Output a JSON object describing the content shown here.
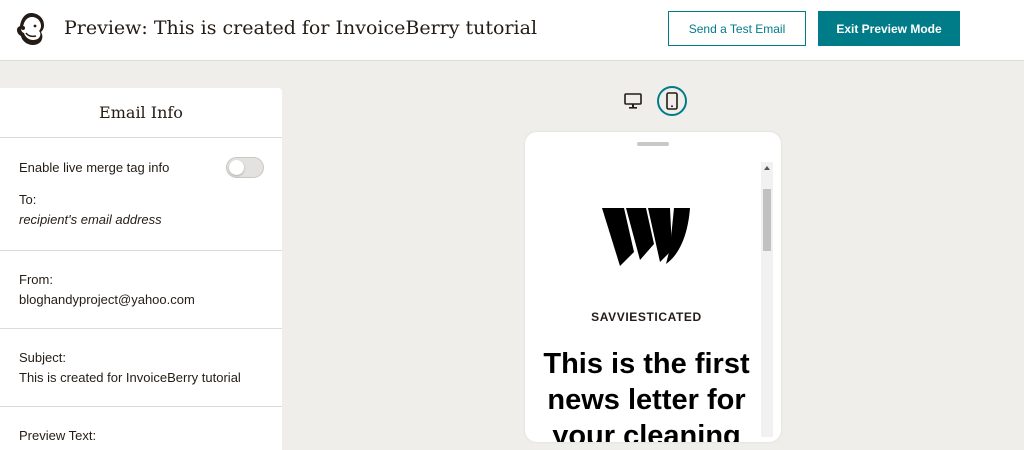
{
  "header": {
    "title": "Preview: This is created for InvoiceBerry tutorial",
    "send_test_label": "Send a Test Email",
    "exit_label": "Exit Preview Mode"
  },
  "panel": {
    "title": "Email Info",
    "toggle_label": "Enable live merge tag info",
    "toggle_on": false,
    "to_label": "To:",
    "to_value": "recipient's email address",
    "from_label": "From:",
    "from_value": "bloghandyproject@yahoo.com",
    "subject_label": "Subject:",
    "subject_value": "This is created for InvoiceBerry tutorial",
    "preview_label": "Preview Text:"
  },
  "device_toggle": {
    "selected": "mobile",
    "icons": [
      "desktop-icon",
      "mobile-icon"
    ]
  },
  "email_preview": {
    "brand_name": "SAVVIESTICATED",
    "headline_lines": [
      "This is the first",
      "news letter for",
      "your cleaning"
    ]
  },
  "colors": {
    "accent": "#007c89",
    "background": "#efeeea",
    "text": "#241c15"
  }
}
